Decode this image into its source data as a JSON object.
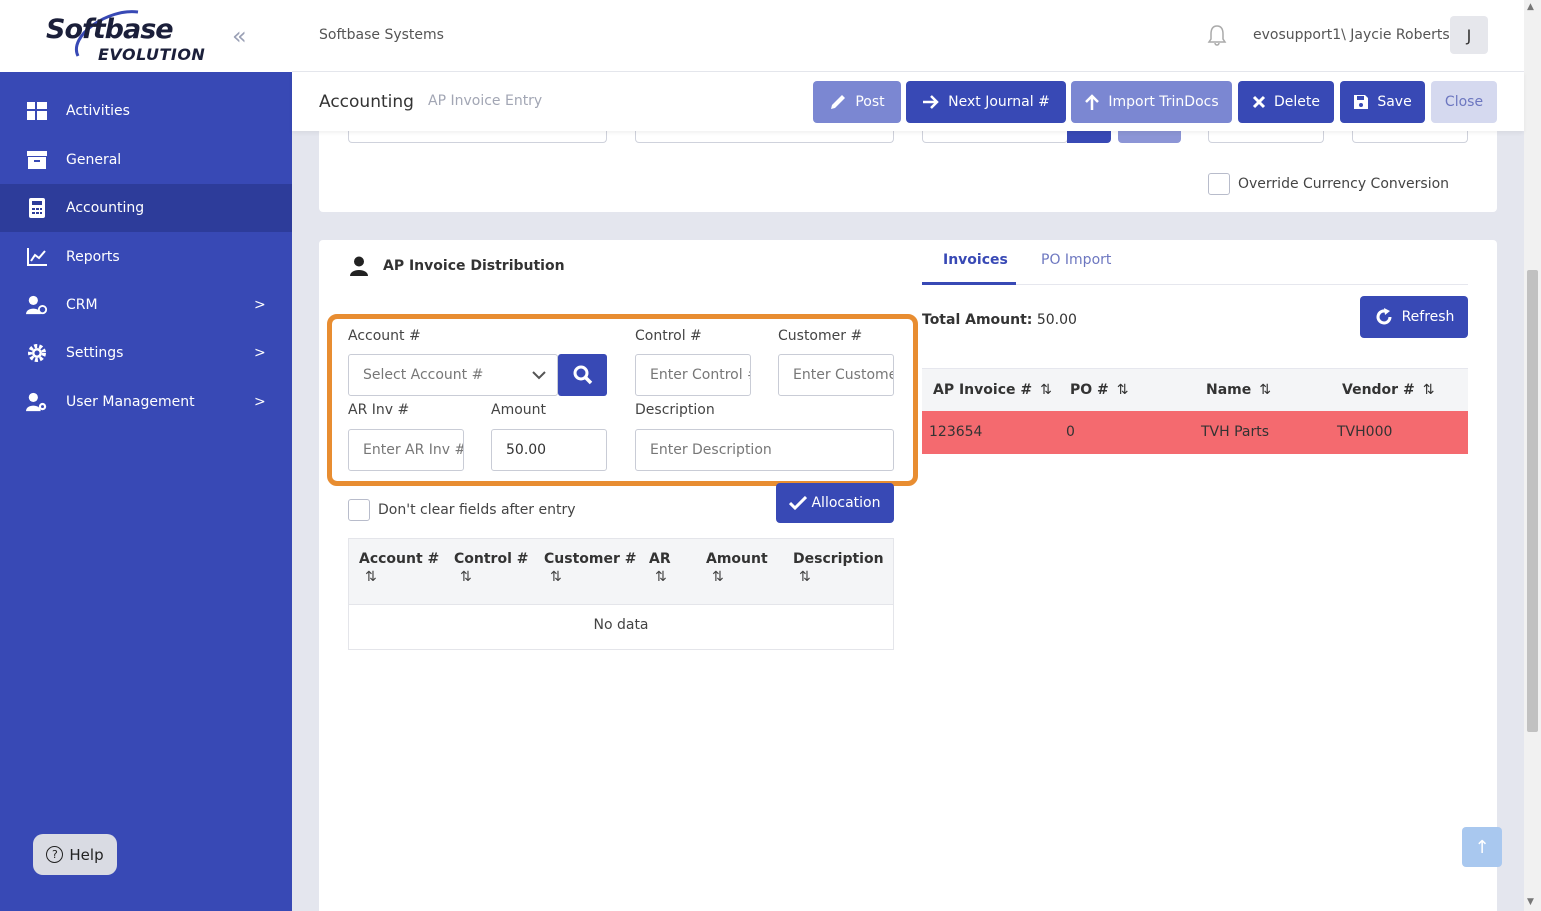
{
  "logo": {
    "line1": "Softbase",
    "line2": "EVOLUTION"
  },
  "sidebar": {
    "items": [
      {
        "label": "Activities",
        "icon": "grid-icon"
      },
      {
        "label": "General",
        "icon": "archive-icon"
      },
      {
        "label": "Accounting",
        "icon": "calculator-icon",
        "active": true
      },
      {
        "label": "Reports",
        "icon": "chart-icon"
      },
      {
        "label": "CRM",
        "icon": "user-cog-icon",
        "chevron": true
      },
      {
        "label": "Settings",
        "icon": "gear-icon",
        "chevron": true
      },
      {
        "label": "User Management",
        "icon": "user-gear-icon",
        "chevron": true
      }
    ],
    "help_label": "Help"
  },
  "header": {
    "company": "Softbase Systems",
    "user": "evosupport1\\ Jaycie Roberts",
    "avatar_initial": "J"
  },
  "subheader": {
    "title": "Accounting",
    "subtitle": "AP Invoice Entry",
    "buttons": {
      "post": "Post",
      "next_journal": "Next Journal #",
      "import_trindocs": "Import TrinDocs",
      "delete": "Delete",
      "save": "Save",
      "close": "Close"
    }
  },
  "top_card": {
    "override_label": "Override Currency Conversion"
  },
  "distribution": {
    "title": "AP Invoice Distribution",
    "fields": {
      "account_label": "Account #",
      "account_placeholder": "Select Account #",
      "control_label": "Control #",
      "control_placeholder": "Enter Control #",
      "customer_label": "Customer #",
      "customer_placeholder": "Enter Customer #",
      "arinv_label": "AR Inv #",
      "arinv_placeholder": "Enter AR Inv #",
      "amount_label": "Amount",
      "amount_value": "50.00",
      "description_label": "Description",
      "description_placeholder": "Enter Description"
    },
    "allocation_label": "Allocation",
    "dont_clear_label": "Don't clear fields after entry",
    "table": {
      "columns": [
        "Account #",
        "Control #",
        "Customer #",
        "AR",
        "Amount",
        "Description"
      ],
      "empty_text": "No data"
    }
  },
  "right_panel": {
    "tabs": [
      "Invoices",
      "PO Import"
    ],
    "total_label": "Total Amount:",
    "total_value": "50.00",
    "refresh_label": "Refresh",
    "columns": [
      "AP Invoice #",
      "PO #",
      "Name",
      "Vendor #"
    ],
    "rows": [
      {
        "ap_invoice": "123654",
        "po": "0",
        "name": "TVH Parts",
        "vendor": "TVH000"
      }
    ]
  },
  "colors": {
    "primary": "#3849b5",
    "highlight": "#e88d31",
    "row_highlight": "#f46a6f"
  }
}
